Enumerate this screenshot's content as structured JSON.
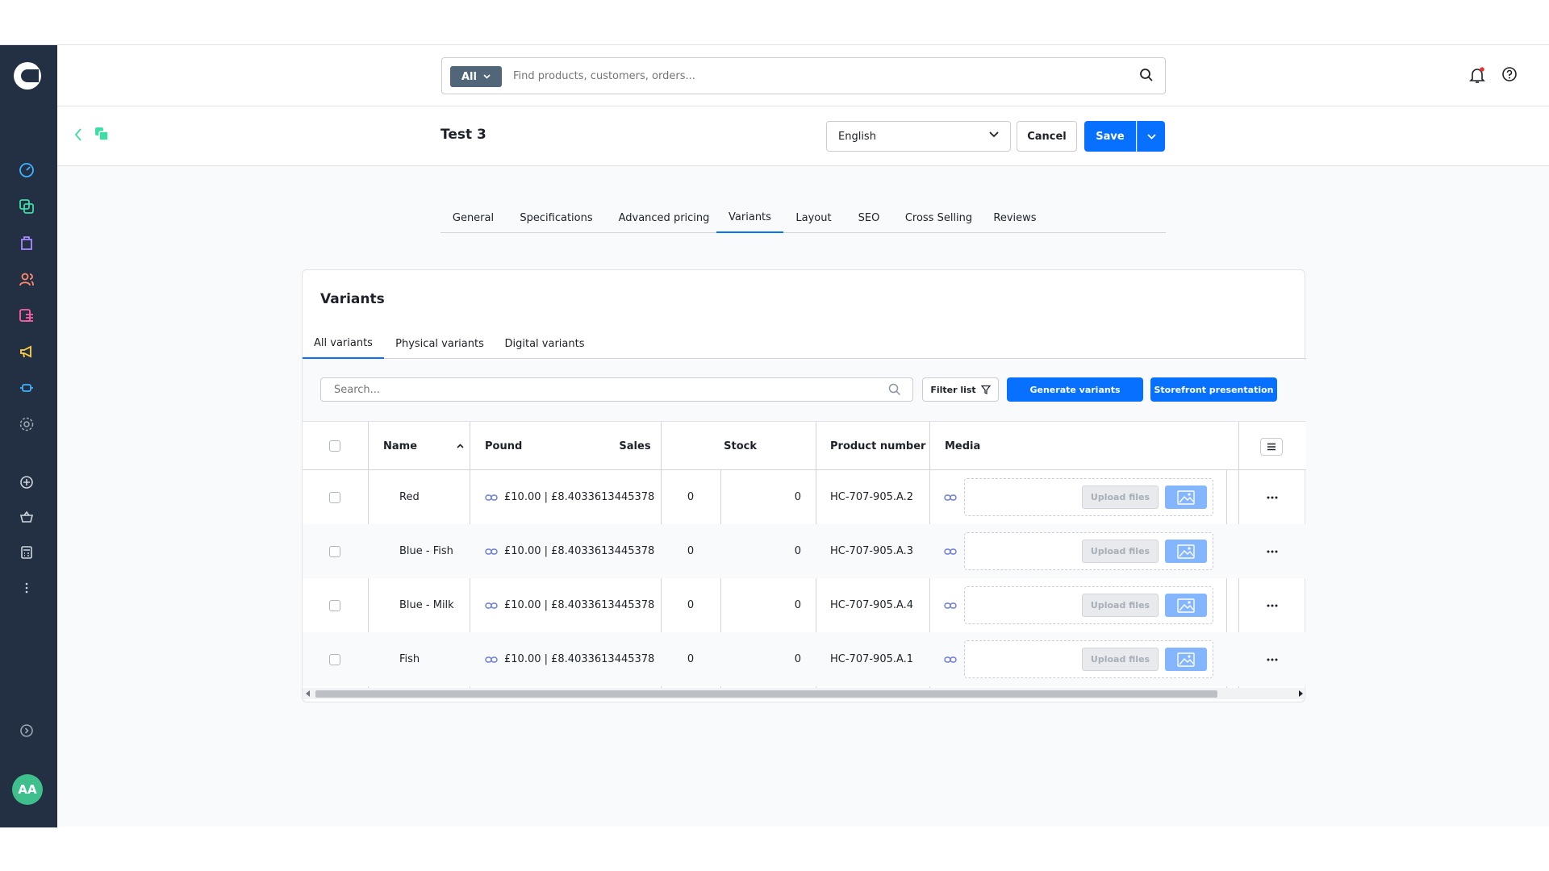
{
  "global_search": {
    "filter_label": "All",
    "placeholder": "Find products, customers, orders..."
  },
  "header": {
    "title": "Test 3",
    "language": "English",
    "cancel_label": "Cancel",
    "save_label": "Save"
  },
  "main_tabs": [
    "General",
    "Specifications",
    "Advanced pricing",
    "Variants",
    "Layout",
    "SEO",
    "Cross Selling",
    "Reviews"
  ],
  "active_main_tab": "Variants",
  "card": {
    "title": "Variants",
    "sub_tabs": [
      "All variants",
      "Physical variants",
      "Digital variants"
    ],
    "search_placeholder": "Search...",
    "filter_label": "Filter list",
    "generate_label": "Generate variants",
    "storefront_label": "Storefront presentation"
  },
  "table": {
    "columns": {
      "name": "Name",
      "pound": "Pound",
      "sales": "Sales",
      "stock": "Stock",
      "product_number": "Product number",
      "media": "Media"
    },
    "upload_label": "Upload files",
    "rows": [
      {
        "name": "Red",
        "price": "£10.00 | £8.4033613445378",
        "sales": "0",
        "stock": "0",
        "product_number": "HC-707-905.A.2"
      },
      {
        "name": "Blue - Fish",
        "price": "£10.00 | £8.4033613445378",
        "sales": "0",
        "stock": "0",
        "product_number": "HC-707-905.A.3"
      },
      {
        "name": "Blue - Milk",
        "price": "£10.00 | £8.4033613445378",
        "sales": "0",
        "stock": "0",
        "product_number": "HC-707-905.A.4"
      },
      {
        "name": "Fish",
        "price": "£10.00 | £8.4033613445378",
        "sales": "0",
        "stock": "0",
        "product_number": "HC-707-905.A.1"
      }
    ]
  },
  "user": {
    "initials": "AA"
  },
  "colors": {
    "sidebar": "#233044",
    "accent": "#0870ff",
    "avatar": "#3fbf8b"
  }
}
